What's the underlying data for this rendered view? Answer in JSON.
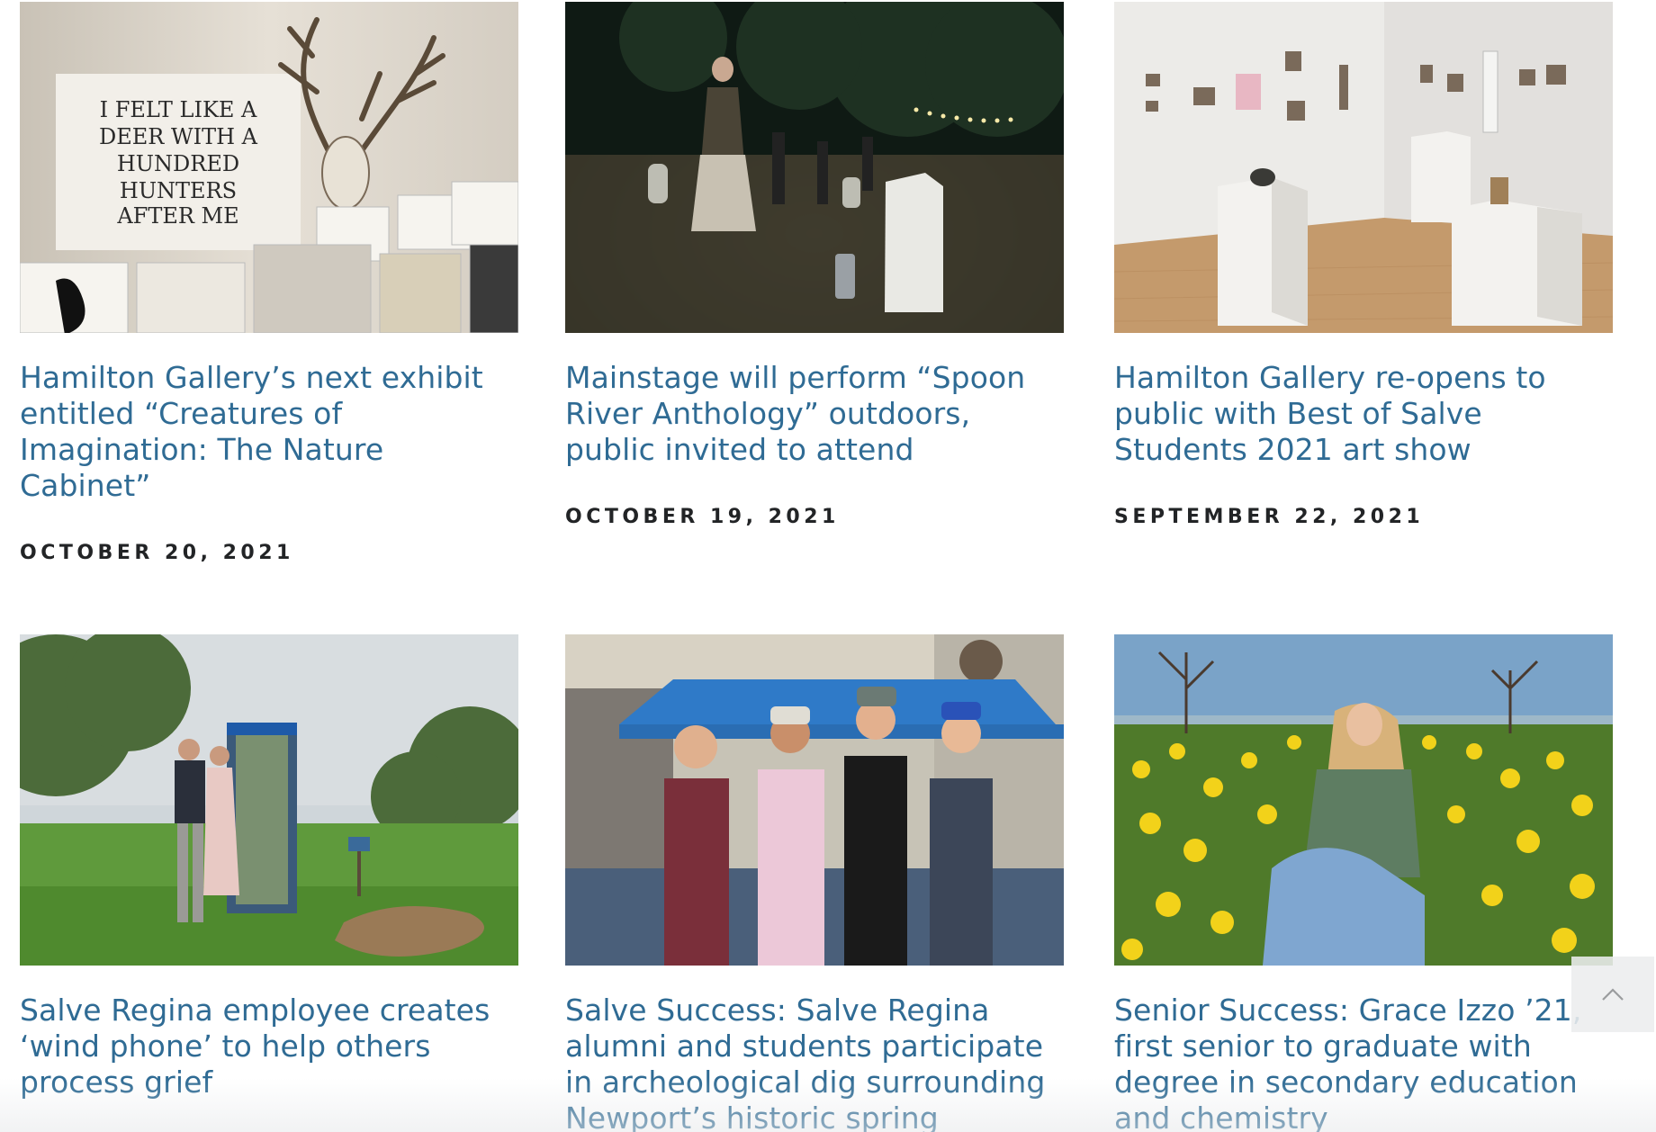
{
  "articles": [
    {
      "title": "Hamilton Gallery’s next exhibit entitled “Creatures of Imagination: The Nature Cabinet”",
      "date": "OCTOBER 20, 2021",
      "image_label": "Hamilton Gallery exhibit wall with deer skull and drawings",
      "sign_lines": [
        "I FELT LIKE A",
        "DEER WITH A",
        "HUNDRED",
        "HUNTERS",
        "AFTER ME"
      ]
    },
    {
      "title": "Mainstage will perform “Spoon River Anthology” outdoors, public invited to attend",
      "date": "OCTOBER 19, 2021",
      "image_label": "Outdoor night theater performance among gravestones"
    },
    {
      "title": "Hamilton Gallery re-opens to public with Best of Salve Students 2021 art show",
      "date": "SEPTEMBER 22, 2021",
      "image_label": "Gallery room with white pedestals and framed artworks"
    },
    {
      "title": "Salve Regina employee creates ‘wind phone’ to help others process grief",
      "date": "",
      "image_label": "Couple standing beside a phone booth in a garden"
    },
    {
      "title": "Salve Success: Salve Regina alumni and students participate in archeological dig surrounding Newport’s historic spring",
      "date": "",
      "image_label": "Four women standing under a blue canopy tent"
    },
    {
      "title": "Senior Success: Grace Izzo ’21, first senior to graduate with degree in secondary education and chemistry",
      "date": "",
      "image_label": "Student sitting in a field of yellow daffodils"
    }
  ],
  "colors": {
    "title": "#2f6b94",
    "date": "#222426",
    "background": "#ffffff"
  },
  "scroll_top_icon": "chevron-up-icon"
}
